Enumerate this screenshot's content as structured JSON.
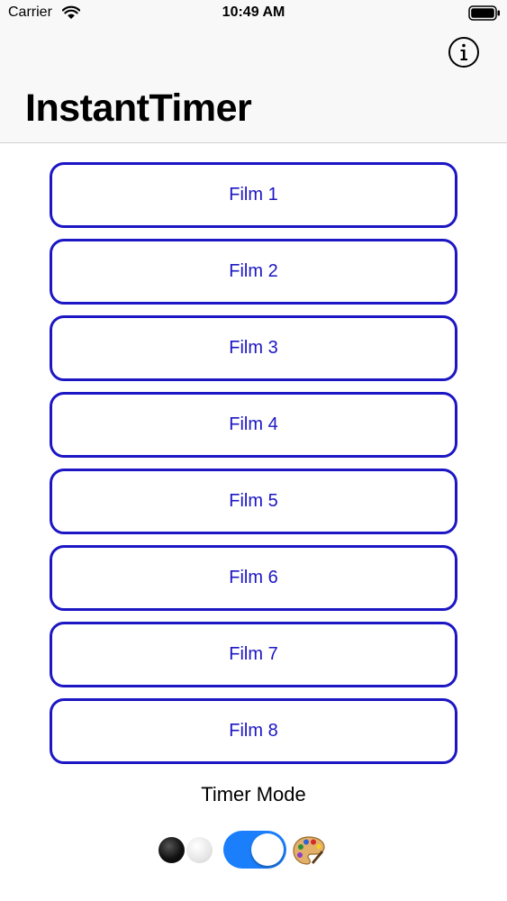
{
  "status_bar": {
    "carrier": "Carrier",
    "time": "10:49 AM"
  },
  "header": {
    "title": "InstantTimer",
    "info_icon": "info-circle-icon"
  },
  "films": [
    {
      "label": "Film 1"
    },
    {
      "label": "Film 2"
    },
    {
      "label": "Film 3"
    },
    {
      "label": "Film 4"
    },
    {
      "label": "Film 5"
    },
    {
      "label": "Film 6"
    },
    {
      "label": "Film 7"
    },
    {
      "label": "Film 8"
    }
  ],
  "timer_mode": {
    "label": "Timer Mode",
    "toggle_on": true,
    "left_icon": "black-white-dots-icon",
    "right_icon": "palette-icon"
  },
  "colors": {
    "accent": "#1c16c4",
    "toggle": "#1b7ffb"
  }
}
